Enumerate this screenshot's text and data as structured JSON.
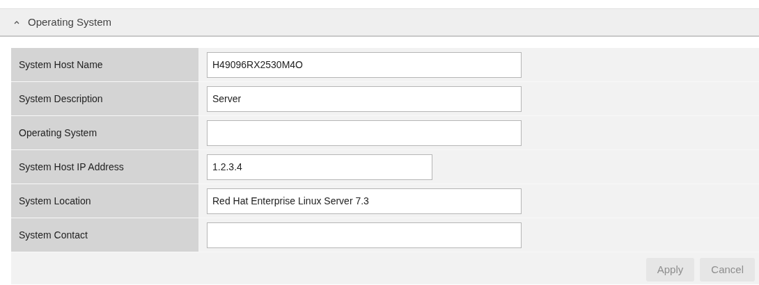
{
  "section": {
    "title": "Operating System",
    "expanded": true
  },
  "fields": [
    {
      "label": "System Host Name",
      "kind": "text",
      "value": "H49096RX2530M4O"
    },
    {
      "label": "System Description",
      "kind": "text",
      "value": "Server"
    },
    {
      "label": "Operating System",
      "kind": "text"
    },
    {
      "label": "System Host IP Address",
      "kind": "ip",
      "value": "1.2.3.4"
    },
    {
      "label": "System Location",
      "kind": "text",
      "value": "Red Hat Enterprise Linux Server 7.3"
    },
    {
      "label": "System Contact",
      "kind": "text"
    }
  ],
  "buttons": [
    {
      "label": "Apply",
      "disabled": true
    },
    {
      "label": "Cancel",
      "disabled": true
    }
  ]
}
